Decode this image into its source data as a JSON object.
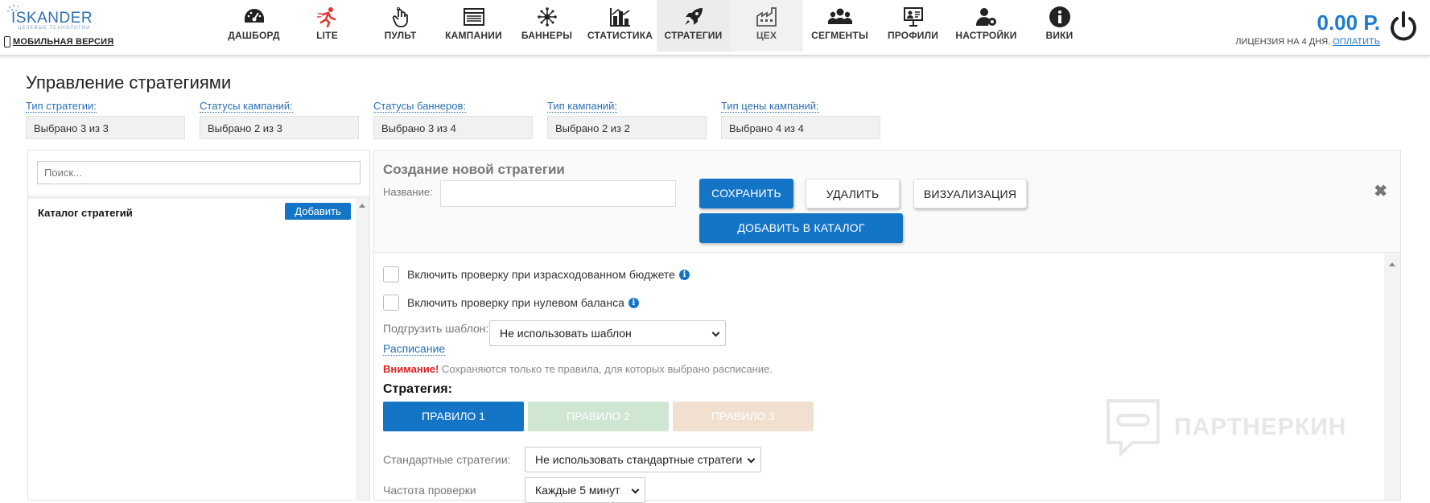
{
  "logo": {
    "name": "ISKANDER",
    "subtitle": "ЦЕЛЕВЫЕ ТЕХНОЛОГИИ",
    "mobile_link": "МОБИЛЬНАЯ ВЕРСИЯ"
  },
  "nav": [
    {
      "label": "ДАШБОРД",
      "icon": "dashboard-gauge-icon"
    },
    {
      "label": "LITE",
      "icon": "runner-icon"
    },
    {
      "label": "ПУЛЬТ",
      "icon": "hand-pointer-icon"
    },
    {
      "label": "КАМПАНИИ",
      "icon": "campaigns-list-icon"
    },
    {
      "label": "БАННЕРЫ",
      "icon": "banners-network-icon"
    },
    {
      "label": "СТАТИСТИКА",
      "icon": "statistics-chart-icon"
    },
    {
      "label": "СТРАТЕГИИ",
      "icon": "rocket-icon",
      "active": true
    },
    {
      "label": "ЦЕХ",
      "icon": "factory-icon",
      "muted": true
    },
    {
      "label": "СЕГМЕНТЫ",
      "icon": "users-group-icon"
    },
    {
      "label": "ПРОФИЛИ",
      "icon": "profiles-presentation-icon"
    },
    {
      "label": "НАСТРОЙКИ",
      "icon": "user-settings-icon"
    },
    {
      "label": "ВИКИ",
      "icon": "info-circle-icon"
    }
  ],
  "balance": {
    "amount": "0.00 Р.",
    "license_text": "ЛИЦЕНЗИЯ НА 4 ДНЯ.",
    "pay_link": "ОПЛАТИТЬ"
  },
  "page_title": "Управление стратегиями",
  "filters": [
    {
      "label": "Тип стратегии:",
      "value": "Выбрано 3 из 3"
    },
    {
      "label": "Статусы кампаний:",
      "value": "Выбрано 2 из 3"
    },
    {
      "label": "Статусы баннеров:",
      "value": "Выбрано 3 из 4"
    },
    {
      "label": "Тип кампаний:",
      "value": "Выбрано 2 из 2"
    },
    {
      "label": "Тип цены кампаний:",
      "value": "Выбрано 4 из 4"
    }
  ],
  "left": {
    "search_placeholder": "Поиск...",
    "catalog_title": "Каталог стратегий",
    "add_button": "Добавить"
  },
  "editor": {
    "title": "Создание новой стратегии",
    "name_label": "Название:",
    "name_value": "",
    "save": "СОХРАНИТЬ",
    "delete": "УДАЛИТЬ",
    "visualize": "ВИЗУАЛИЗАЦИЯ",
    "add_to_catalog": "ДОБАВИТЬ В КАТАЛОГ",
    "close": "✖",
    "check_budget": "Включить проверку при израсходованном бюджете",
    "check_zero_balance": "Включить проверку при нулевом баланса",
    "template_label": "Подгрузить шаблон:",
    "template_value": "Не использовать шаблон",
    "schedule_link": "Расписание",
    "warning_strong": "Внимание!",
    "warning_text": " Сохраняются только те правила, для которых выбрано расписание.",
    "strategy_title": "Стратегия:",
    "rules": [
      {
        "label": "ПРАВИЛО 1",
        "color": "#1475c6"
      },
      {
        "label": "ПРАВИЛО 2",
        "color": "#cfe6d3"
      },
      {
        "label": "ПРАВИЛО 3",
        "color": "#f1e0d0"
      }
    ],
    "std_label": "Стандартные стратегии:",
    "std_value": "Не использовать стандартные стратеги",
    "freq_label": "Частота проверки",
    "freq_value": "Каждые 5 минут"
  },
  "watermark": "ПАРТНЕРКИН",
  "colors": {
    "accent": "#1475c6",
    "balance": "#1e7bd0",
    "warning": "#e02020"
  }
}
